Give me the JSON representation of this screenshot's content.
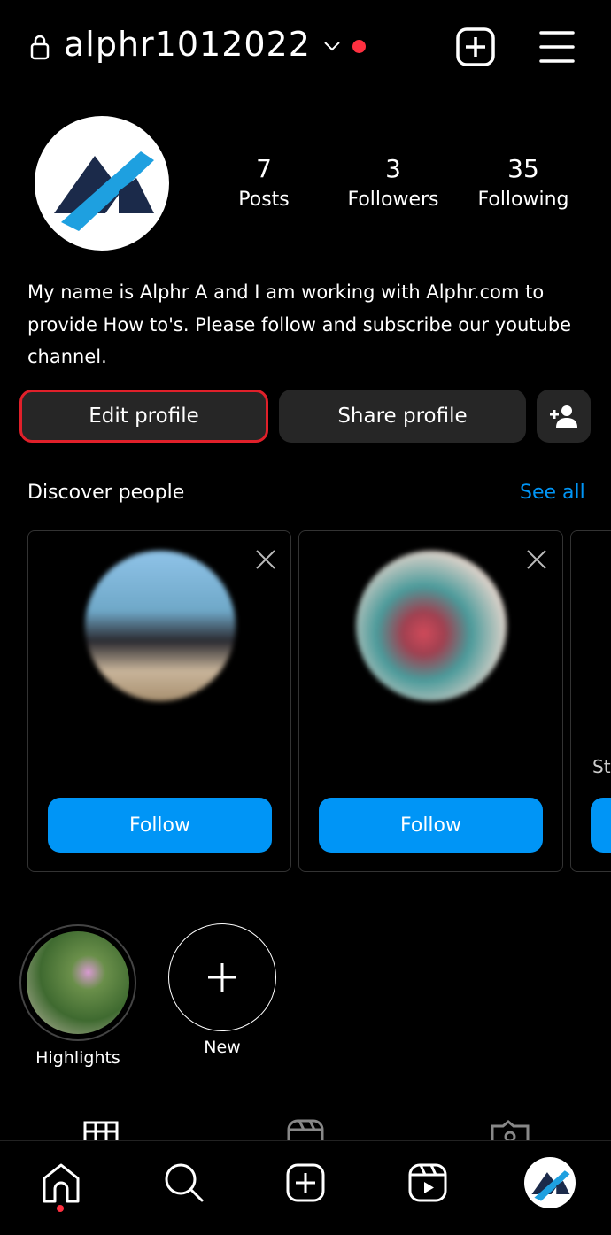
{
  "header": {
    "username": "alphr1012022",
    "icons": [
      "lock-icon",
      "chevron-down-icon",
      "notification-dot",
      "create-icon",
      "menu-icon"
    ]
  },
  "profile": {
    "stats": [
      {
        "value": "7",
        "label": "Posts"
      },
      {
        "value": "3",
        "label": "Followers"
      },
      {
        "value": "35",
        "label": "Following"
      }
    ],
    "bio": "My name is Alphr A and I am working with Alphr.com to provide How to's. Please follow and subscribe our youtube channel.",
    "edit_label": "Edit profile",
    "share_label": "Share profile"
  },
  "discover": {
    "title": "Discover people",
    "see_all": "See all",
    "cards": [
      {
        "follow": "Follow"
      },
      {
        "follow": "Follow"
      },
      {
        "partial_text": "St"
      }
    ]
  },
  "highlights": [
    {
      "label": "Highlights"
    },
    {
      "label": "New"
    }
  ],
  "colors": {
    "accent": "#0095f6",
    "highlight_border": "#e0202a",
    "notification": "#ff3040"
  }
}
